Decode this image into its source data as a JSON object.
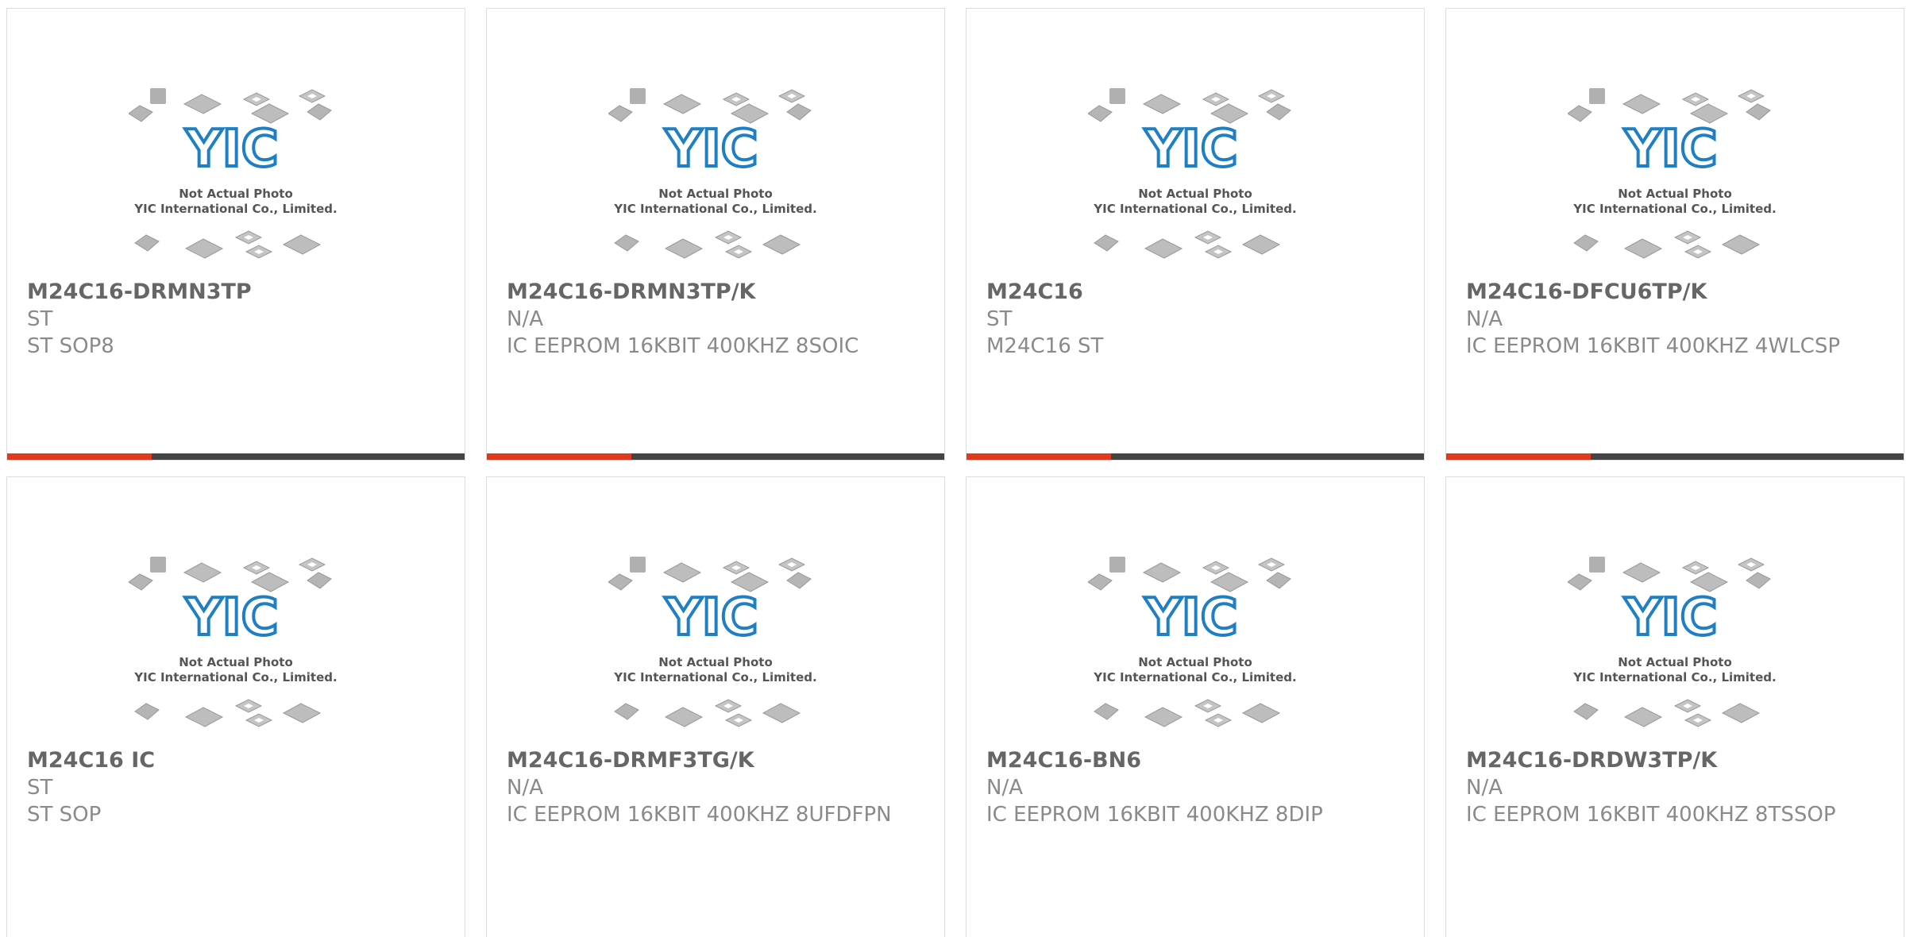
{
  "placeholder": {
    "caption_line1": "Not Actual Photo",
    "caption_line2": "YIC International Co., Limited.",
    "logo_text": "YIC"
  },
  "colors": {
    "accent": "#e03a1e",
    "bar": "#444444",
    "logo": "#1e7fc4"
  },
  "products": [
    {
      "part": "M24C16-DRMN3TP",
      "mfr": "ST",
      "desc": "ST SOP8"
    },
    {
      "part": "M24C16-DRMN3TP/K",
      "mfr": "N/A",
      "desc": "IC EEPROM 16KBIT 400KHZ 8SOIC"
    },
    {
      "part": "M24C16",
      "mfr": "ST",
      "desc": "M24C16 ST"
    },
    {
      "part": "M24C16-DFCU6TP/K",
      "mfr": "N/A",
      "desc": "IC EEPROM 16KBIT 400KHZ 4WLCSP"
    },
    {
      "part": "M24C16 IC",
      "mfr": "ST",
      "desc": "ST SOP"
    },
    {
      "part": "M24C16-DRMF3TG/K",
      "mfr": "N/A",
      "desc": "IC EEPROM 16KBIT 400KHZ 8UFDFPN"
    },
    {
      "part": "M24C16-BN6",
      "mfr": "N/A",
      "desc": "IC EEPROM 16KBIT 400KHZ 8DIP"
    },
    {
      "part": "M24C16-DRDW3TP/K",
      "mfr": "N/A",
      "desc": "IC EEPROM 16KBIT 400KHZ 8TSSOP"
    }
  ]
}
